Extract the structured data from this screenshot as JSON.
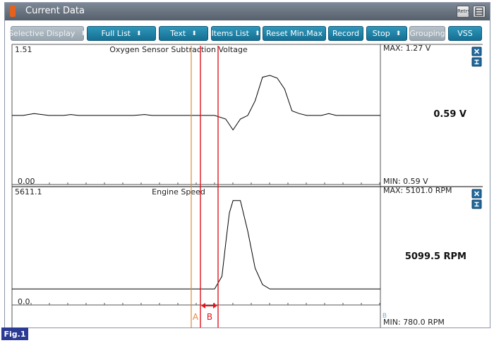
{
  "window": {
    "title": "Current Data"
  },
  "toolbar": {
    "buttons": [
      {
        "label": "Selective Display",
        "has_arrows": true,
        "disabled": true
      },
      {
        "label": "Full List",
        "has_arrows": true,
        "disabled": false
      },
      {
        "label": "Text",
        "has_arrows": true,
        "disabled": false
      },
      {
        "label": "Items List",
        "has_arrows": true,
        "disabled": false
      },
      {
        "label": "Reset Min.Max",
        "has_arrows": false,
        "disabled": false
      },
      {
        "label": "Record",
        "has_arrows": false,
        "disabled": false
      },
      {
        "label": "Stop",
        "has_arrows": true,
        "disabled": false
      },
      {
        "label": "Grouping",
        "has_arrows": false,
        "disabled": true
      },
      {
        "label": "VSS",
        "has_arrows": false,
        "disabled": false
      }
    ],
    "retry_icon_text": "Retry"
  },
  "panels": [
    {
      "title": "Oxygen Sensor Subtraction Voltage",
      "y_max_label": "1.51",
      "y_min_label": "0.00",
      "max_text": "MAX:  1.27 V",
      "min_text": "MIN:  0.59 V",
      "current_value": "0.59 V"
    },
    {
      "title": "Engine Speed",
      "y_max_label": "5611.1",
      "y_min_label": "0.0",
      "max_text": "MAX: 5101.0 RPM",
      "min_text": "MIN: 780.0 RPM",
      "current_value": "5099.5 RPM"
    }
  ],
  "markers": {
    "a_label": "A",
    "b_label": "B",
    "extra_label": "B"
  },
  "figure_label": "Fig.1",
  "colors": {
    "accent_button": "#1d84a9",
    "cursor_a": "#e08a3c",
    "cursor_b": "#e0141e",
    "trace": "#000000"
  },
  "chart_data": [
    {
      "type": "line",
      "title": "Oxygen Sensor Subtraction Voltage",
      "ylim": [
        0.0,
        1.51
      ],
      "series": [
        {
          "x": [
            0,
            3,
            6,
            10,
            14,
            16,
            18,
            20,
            25,
            33,
            36,
            38,
            40,
            45,
            55,
            58,
            60,
            62,
            64,
            66,
            68,
            70,
            72,
            74,
            76,
            78,
            80,
            82,
            84,
            86,
            88,
            90,
            92,
            94,
            96,
            98,
            100
          ],
          "values": [
            0.76,
            0.76,
            0.78,
            0.76,
            0.76,
            0.77,
            0.76,
            0.76,
            0.76,
            0.76,
            0.77,
            0.76,
            0.76,
            0.76,
            0.76,
            0.72,
            0.6,
            0.72,
            0.76,
            0.92,
            1.18,
            1.2,
            1.17,
            1.05,
            0.81,
            0.78,
            0.76,
            0.76,
            0.76,
            0.78,
            0.76,
            0.76,
            0.76,
            0.76,
            0.76,
            0.76,
            0.76
          ]
        }
      ]
    },
    {
      "type": "line",
      "title": "Engine Speed",
      "ylim": [
        0.0,
        5611.1
      ],
      "series": [
        {
          "x": [
            0,
            30,
            45,
            55,
            57,
            58,
            59,
            60,
            62,
            64,
            66,
            68,
            70,
            72,
            75,
            80,
            100
          ],
          "values": [
            780,
            780,
            780,
            780,
            1400,
            3000,
            4500,
            5101,
            5101,
            3600,
            1800,
            1000,
            780,
            780,
            780,
            780,
            780
          ]
        }
      ]
    }
  ]
}
